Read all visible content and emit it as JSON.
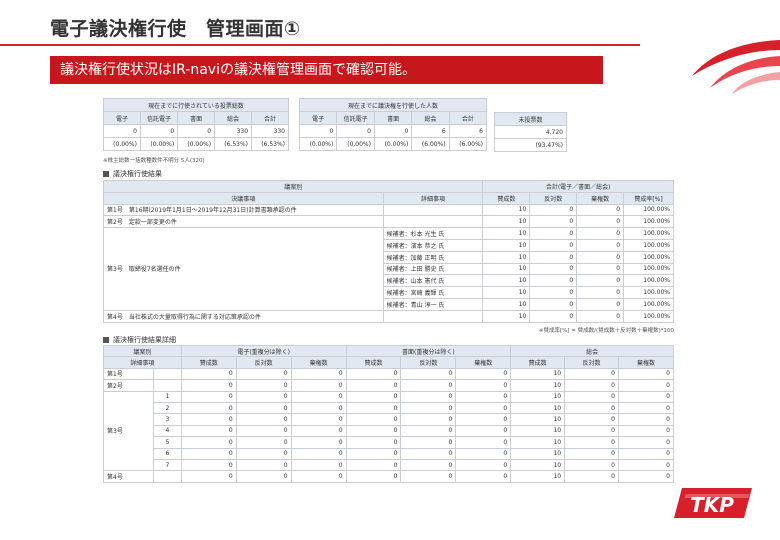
{
  "page_title": "電子議決権行使　管理画面①",
  "banner_text": "議決権行使状況はIR-naviの議決権管理画面で確認可能。",
  "summary_exercised_votes": {
    "title": "現在までに行使されている投票総数",
    "headers": [
      "電子",
      "信託電子",
      "書面",
      "総会",
      "合計"
    ],
    "counts": [
      "0",
      "0",
      "0",
      "330",
      "330"
    ],
    "percents": [
      "(0.00%)",
      "(0.00%)",
      "(0.00%)",
      "(6.53%)",
      "(6.53%)"
    ]
  },
  "summary_exercised_holders": {
    "title": "現在までに議決権を行使した人数",
    "headers": [
      "電子",
      "信託電子",
      "書面",
      "総会",
      "合計"
    ],
    "counts": [
      "0",
      "0",
      "0",
      "6",
      "6"
    ],
    "percents": [
      "(0.00%)",
      "(0.00%)",
      "(0.00%)",
      "(6.00%)",
      "(6.00%)"
    ]
  },
  "summary_unvoted": {
    "title": "未投票数",
    "count": "4,720",
    "percent": "(93.47%)"
  },
  "summary_note": "※株主総数一括数種数件不明分 5人(320)",
  "results_section": {
    "heading": "議決権行使結果",
    "group_header": "議案別",
    "total_header": "合計(電子／書面／総会)",
    "col_proposal": "決議事項",
    "col_detail": "詳細事項",
    "col_for": "賛成数",
    "col_against": "反対数",
    "col_abstain": "棄権数",
    "col_rate": "賛成率[%]",
    "rows": [
      {
        "no": "第1号",
        "proposal": "第1号　第16期(2019年1月1日～2019年12月31日)計算書類承認の件",
        "detail": "",
        "for": "10",
        "against": "0",
        "abstain": "0",
        "rate": "100.00%"
      },
      {
        "no": "第2号",
        "proposal": "第2号　定款一部変更の件",
        "detail": "",
        "for": "10",
        "against": "0",
        "abstain": "0",
        "rate": "100.00%"
      }
    ],
    "p3_proposal": "第3号　取締役7名選任の件",
    "p3_candidates": [
      {
        "detail": "候補者：杉本 光生 氏",
        "for": "10",
        "against": "0",
        "abstain": "0",
        "rate": "100.00%"
      },
      {
        "detail": "候補者：濱本 恭之 氏",
        "for": "10",
        "against": "0",
        "abstain": "0",
        "rate": "100.00%"
      },
      {
        "detail": "候補者：加藤 正明 氏",
        "for": "10",
        "against": "0",
        "abstain": "0",
        "rate": "100.00%"
      },
      {
        "detail": "候補者：上田 勝史 氏",
        "for": "10",
        "against": "0",
        "abstain": "0",
        "rate": "100.00%"
      },
      {
        "detail": "候補者：山本 憲代 氏",
        "for": "10",
        "against": "0",
        "abstain": "0",
        "rate": "100.00%"
      },
      {
        "detail": "候補者：宮崎 義輝 氏",
        "for": "10",
        "against": "0",
        "abstain": "0",
        "rate": "100.00%"
      },
      {
        "detail": "候補者：青山 淳一 氏",
        "for": "10",
        "against": "0",
        "abstain": "0",
        "rate": "100.00%"
      }
    ],
    "p4": {
      "proposal": "第4号　当社株式の大量取得行為に関する対応策承認の件",
      "detail": "",
      "for": "10",
      "against": "0",
      "abstain": "0",
      "rate": "100.00%"
    },
    "formula_note": "※賛成率[%] = 賛成数/(賛成数＋反対数＋棄権数)*100"
  },
  "detail_section": {
    "heading": "議決権行使結果詳細",
    "col_proposal_group": "議案別",
    "col_detail": "詳細事項",
    "group_electronic": "電子(重複分は除く)",
    "group_paper": "書面(重複分は除く)",
    "group_meeting": "総会",
    "col_for": "賛成数",
    "col_against": "反対数",
    "col_abstain": "棄権数",
    "rows": [
      {
        "no": "第1号",
        "sub": "",
        "vals": [
          "0",
          "0",
          "0",
          "0",
          "0",
          "0",
          "10",
          "0",
          "0"
        ]
      },
      {
        "no": "第2号",
        "sub": "",
        "vals": [
          "0",
          "0",
          "0",
          "0",
          "0",
          "0",
          "10",
          "0",
          "0"
        ]
      }
    ],
    "p3_label": "第3号",
    "p3_rows": [
      {
        "sub": "1",
        "vals": [
          "0",
          "0",
          "0",
          "0",
          "0",
          "0",
          "10",
          "0",
          "0"
        ]
      },
      {
        "sub": "2",
        "vals": [
          "0",
          "0",
          "0",
          "0",
          "0",
          "0",
          "10",
          "0",
          "0"
        ]
      },
      {
        "sub": "3",
        "vals": [
          "0",
          "0",
          "0",
          "0",
          "0",
          "0",
          "10",
          "0",
          "0"
        ]
      },
      {
        "sub": "4",
        "vals": [
          "0",
          "0",
          "0",
          "0",
          "0",
          "0",
          "10",
          "0",
          "0"
        ]
      },
      {
        "sub": "5",
        "vals": [
          "0",
          "0",
          "0",
          "0",
          "0",
          "0",
          "10",
          "0",
          "0"
        ]
      },
      {
        "sub": "6",
        "vals": [
          "0",
          "0",
          "0",
          "0",
          "0",
          "0",
          "10",
          "0",
          "0"
        ]
      },
      {
        "sub": "7",
        "vals": [
          "0",
          "0",
          "0",
          "0",
          "0",
          "0",
          "10",
          "0",
          "0"
        ]
      }
    ],
    "p4_row": {
      "no": "第4号",
      "sub": "",
      "vals": [
        "0",
        "0",
        "0",
        "0",
        "0",
        "0",
        "10",
        "0",
        "0"
      ]
    }
  },
  "logo_text": "TKP",
  "colors": {
    "accent": "#c8161d",
    "header_bg": "#e1e8f1",
    "border": "#c9ced6"
  }
}
